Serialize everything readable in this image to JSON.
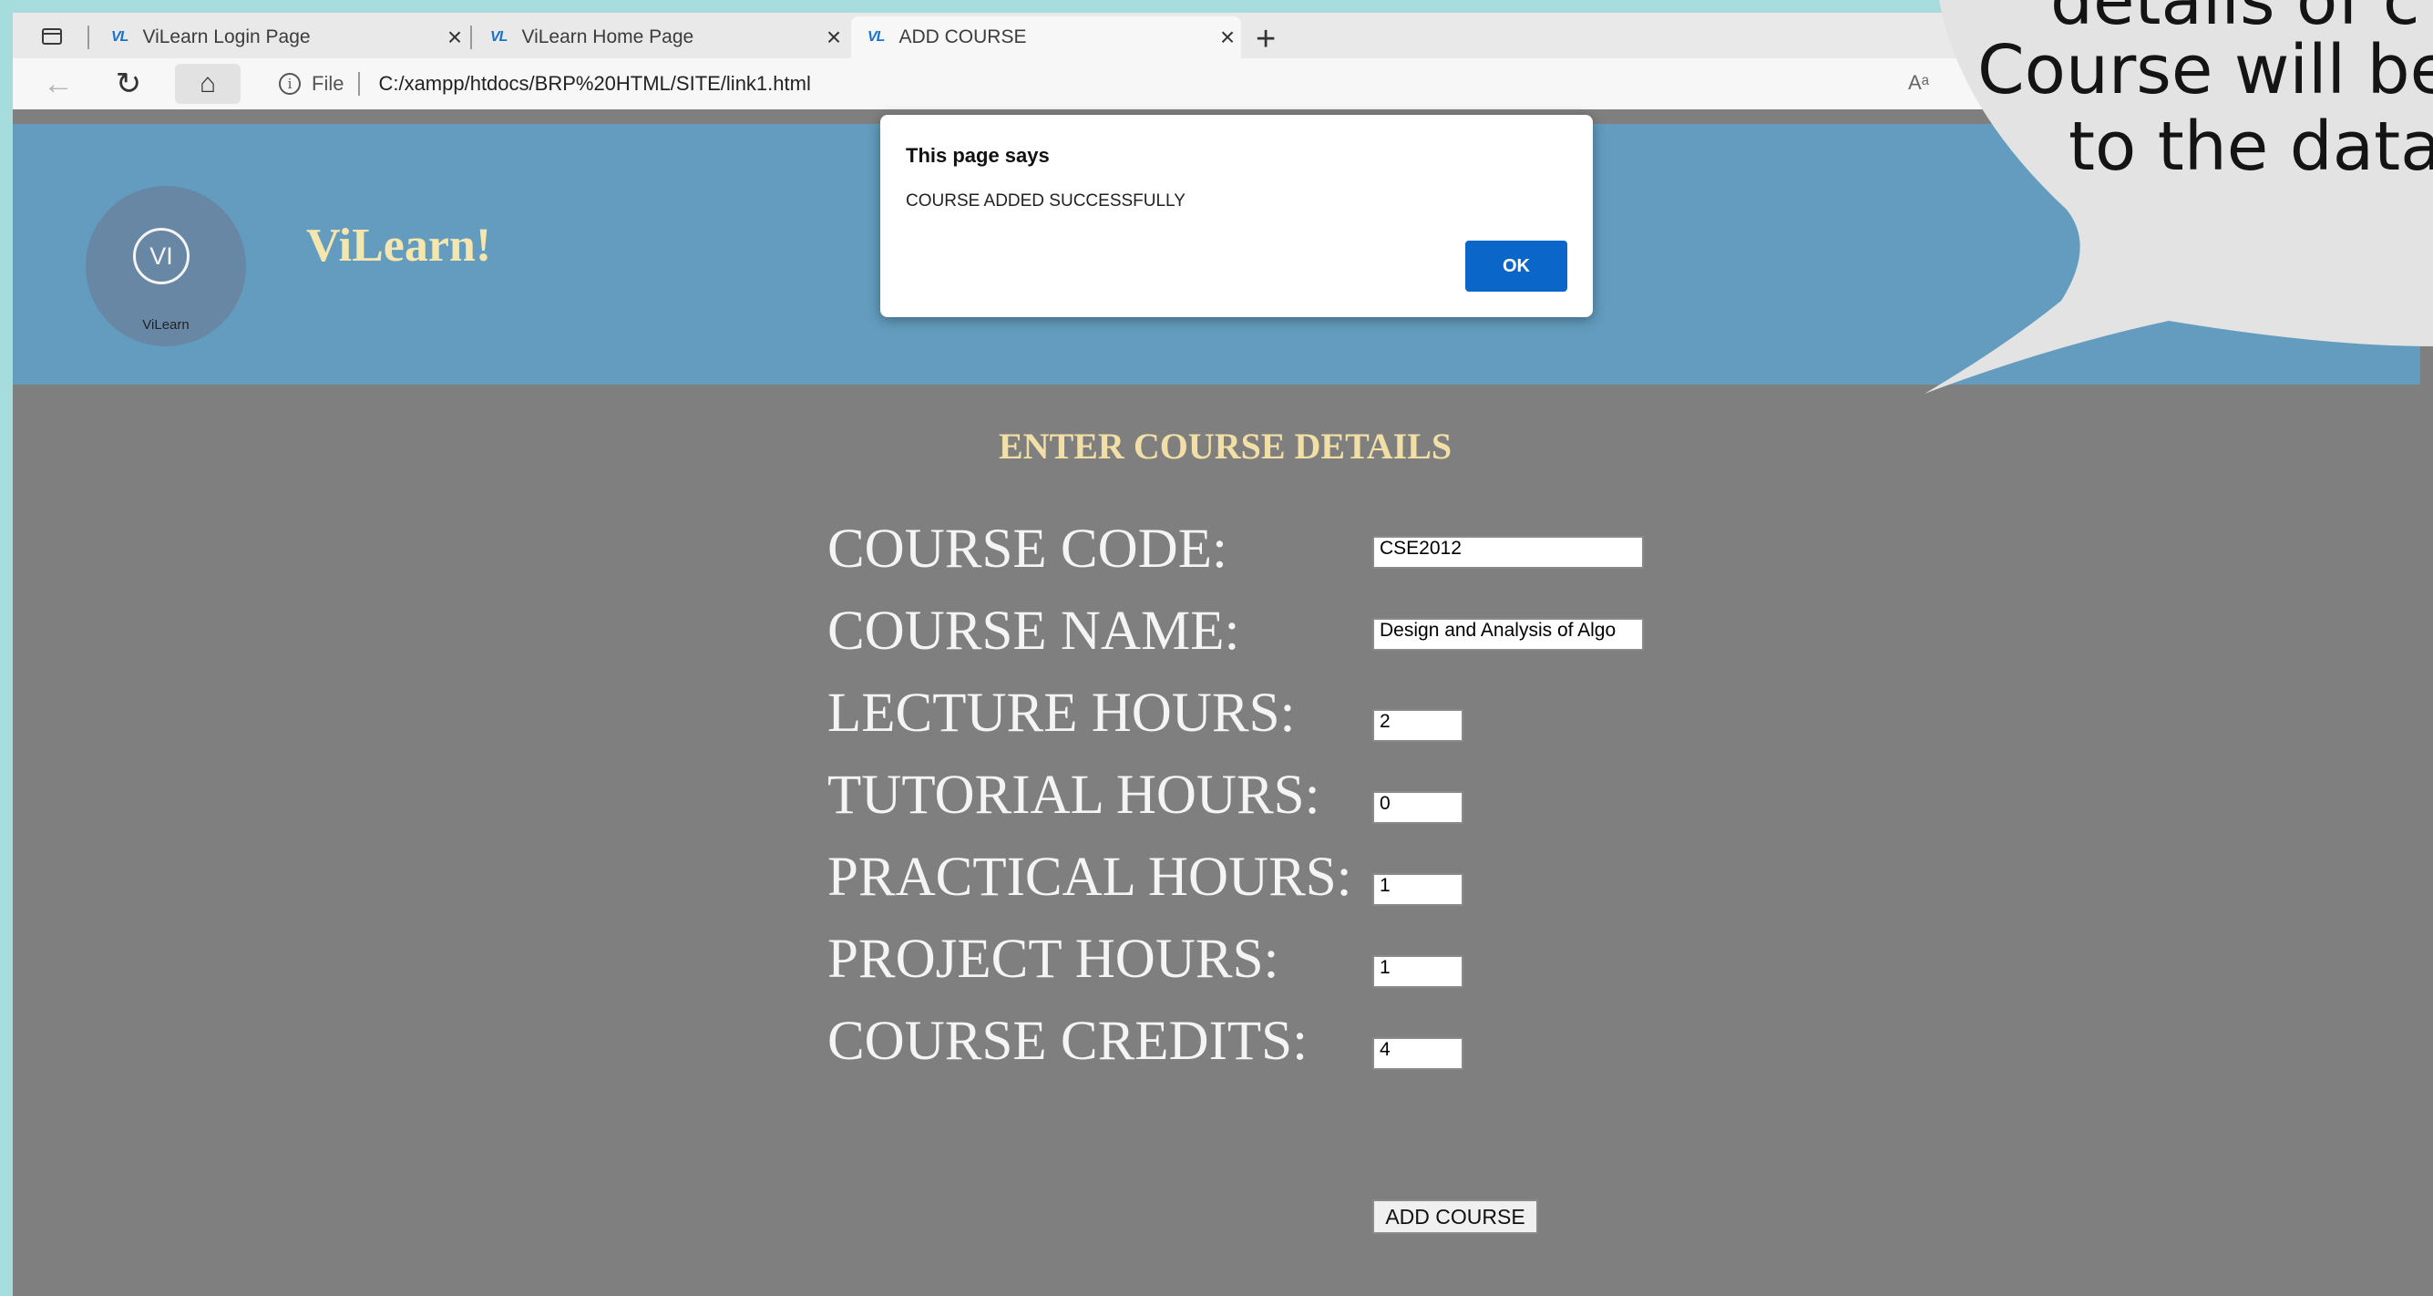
{
  "browser": {
    "tabs": [
      {
        "favicon": "VL",
        "title": "ViLearn Login Page",
        "active": false
      },
      {
        "favicon": "VL",
        "title": "ViLearn Home Page",
        "active": false
      },
      {
        "favicon": "VL",
        "title": "ADD COURSE",
        "active": true
      }
    ],
    "new_tab_symbol": "+",
    "close_symbol": "×",
    "file_label": "File",
    "url": "C:/xampp/htdocs/BRP%20HTML/SITE/link1.html",
    "read_aloud_label": "Aᵃ"
  },
  "header": {
    "logo_mark": "VI",
    "logo_caption": "ViLearn",
    "site_title": "ViLearn!"
  },
  "form": {
    "title": "ENTER COURSE DETAILS",
    "fields": [
      {
        "label": "COURSE CODE:",
        "value": "CSE2012"
      },
      {
        "label": "COURSE NAME:",
        "value": "Design and Analysis of Algo"
      },
      {
        "label": "LECTURE HOURS:",
        "value": "2"
      },
      {
        "label": "TUTORIAL HOURS:",
        "value": "0"
      },
      {
        "label": "PRACTICAL HOURS:",
        "value": "1"
      },
      {
        "label": "PROJECT HOURS:",
        "value": "1"
      },
      {
        "label": "COURSE CREDITS:",
        "value": "4"
      }
    ],
    "submit_label": "ADD COURSE"
  },
  "alert": {
    "title": "This page says",
    "message": "COURSE ADDED SUCCESSFULLY",
    "ok_label": "OK"
  },
  "callout": {
    "line1": "details of c",
    "line2": "Course will be",
    "line3": "to the data"
  },
  "colors": {
    "header_bg": "#639cbe",
    "page_bg": "#7f7f7f",
    "title_gold": "#f1dfa6",
    "dialog_button": "#0a67c9",
    "outer_frame": "#a6dcdc"
  },
  "icons": [
    "tab-actions-icon",
    "favicon-icon",
    "close-icon",
    "new-tab-icon",
    "back-arrow-icon",
    "reload-icon",
    "home-icon",
    "info-icon",
    "read-aloud-icon",
    "logo-icon"
  ]
}
